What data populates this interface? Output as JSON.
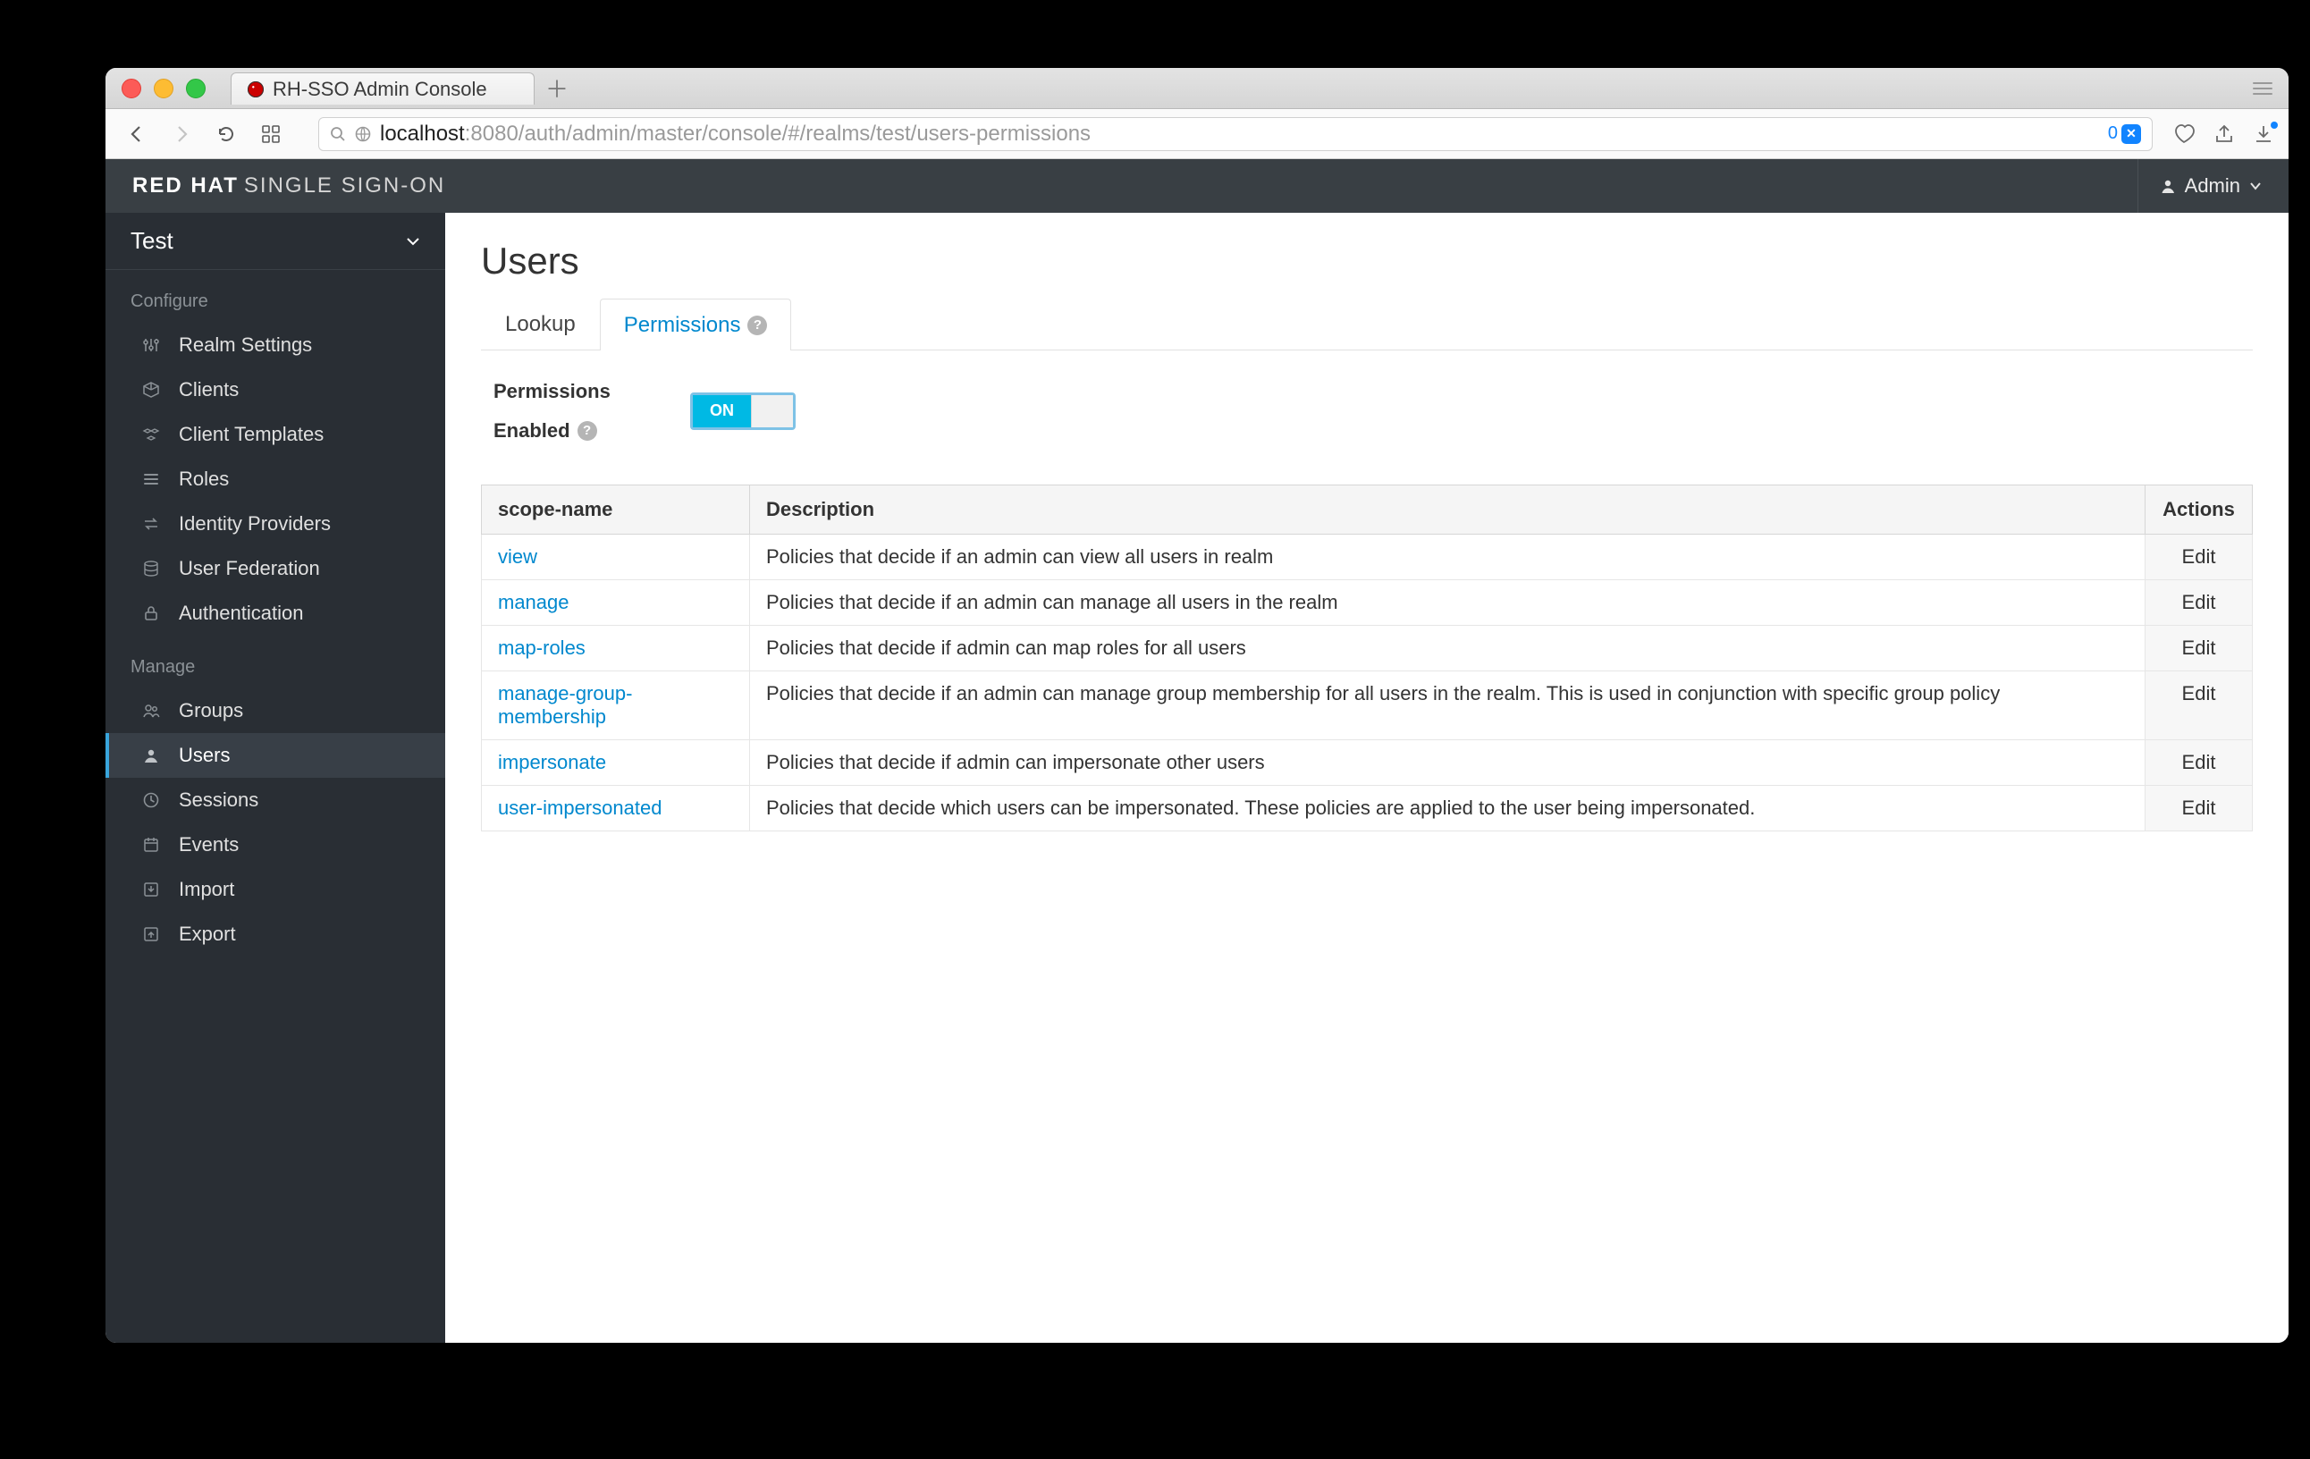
{
  "browser": {
    "tab_title": "RH-SSO Admin Console",
    "url_host": "localhost",
    "url_path": ":8080/auth/admin/master/console/#/realms/test/users-permissions",
    "shield_count": "0"
  },
  "header": {
    "brand_bold": "RED HAT",
    "brand_thin": "SINGLE SIGN-ON",
    "user_label": "Admin"
  },
  "sidebar": {
    "realm": "Test",
    "section_configure": "Configure",
    "section_manage": "Manage",
    "configure_items": [
      {
        "label": "Realm Settings"
      },
      {
        "label": "Clients"
      },
      {
        "label": "Client Templates"
      },
      {
        "label": "Roles"
      },
      {
        "label": "Identity Providers"
      },
      {
        "label": "User Federation"
      },
      {
        "label": "Authentication"
      }
    ],
    "manage_items": [
      {
        "label": "Groups"
      },
      {
        "label": "Users"
      },
      {
        "label": "Sessions"
      },
      {
        "label": "Events"
      },
      {
        "label": "Import"
      },
      {
        "label": "Export"
      }
    ]
  },
  "page": {
    "title": "Users",
    "tab_lookup": "Lookup",
    "tab_permissions": "Permissions",
    "perm_enabled_label_a": "Permissions",
    "perm_enabled_label_b": "Enabled",
    "toggle_on": "ON"
  },
  "table": {
    "col_scope": "scope-name",
    "col_desc": "Description",
    "col_actions": "Actions",
    "edit": "Edit",
    "rows": [
      {
        "scope": "view",
        "desc": "Policies that decide if an admin can view all users in realm"
      },
      {
        "scope": "manage",
        "desc": "Policies that decide if an admin can manage all users in the realm"
      },
      {
        "scope": "map-roles",
        "desc": "Policies that decide if admin can map roles for all users"
      },
      {
        "scope": "manage-group-membership",
        "desc": "Policies that decide if an admin can manage group membership for all users in the realm. This is used in conjunction with specific group policy"
      },
      {
        "scope": "impersonate",
        "desc": "Policies that decide if admin can impersonate other users"
      },
      {
        "scope": "user-impersonated",
        "desc": "Policies that decide which users can be impersonated. These policies are applied to the user being impersonated."
      }
    ]
  }
}
